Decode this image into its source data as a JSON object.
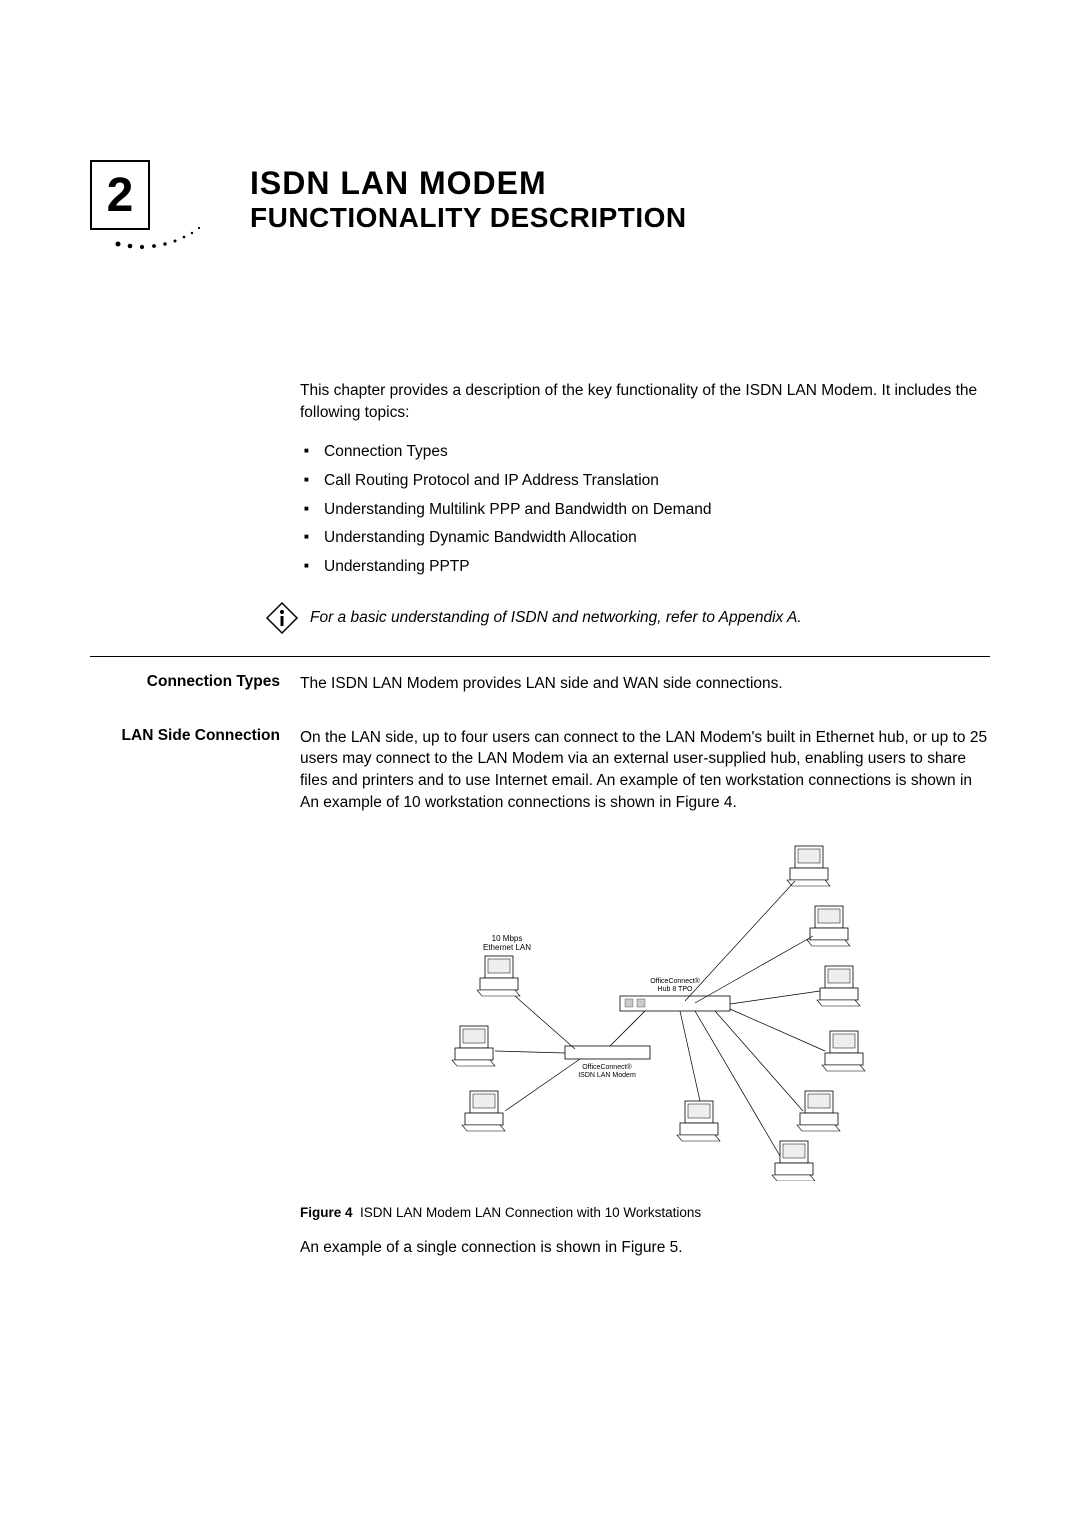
{
  "chapter": {
    "number": "2",
    "title_line1": "ISDN LAN MODEM",
    "title_line2": "FUNCTIONALITY DESCRIPTION"
  },
  "intro": "This chapter provides a description of the key functionality of the ISDN LAN Modem. It includes the following topics:",
  "topics": [
    "Connection Types",
    "Call Routing Protocol and IP Address Translation",
    "Understanding Multilink PPP and Bandwidth on Demand",
    "Understanding Dynamic Bandwidth Allocation",
    "Understanding PPTP"
  ],
  "note": "For a basic understanding of ISDN and networking, refer to Appendix A.",
  "sections": {
    "connection_types": {
      "heading": "Connection Types",
      "text": "The ISDN LAN Modem provides LAN side and WAN side connections."
    },
    "lan_side": {
      "heading": "LAN Side Connection",
      "text": "On the LAN side, up to four users can connect to the LAN Modem's built in Ethernet hub, or up to 25 users may connect to the LAN Modem via an external user-supplied hub, enabling users to share files and printers and to use Internet email. An example of ten workstation connections is shown in An example of 10 workstation connections is shown in Figure 4."
    }
  },
  "diagram_labels": {
    "lan_label": "10 Mbps\nEthernet LAN",
    "hub_label": "OfficeConnect®\nHub 8 TPO",
    "modem_label": "OfficeConnect®\nISDN LAN Modem"
  },
  "figure": {
    "label": "Figure 4",
    "caption": "ISDN LAN Modem LAN Connection with 10 Workstations"
  },
  "closing": "An example of a single connection is shown in Figure 5."
}
